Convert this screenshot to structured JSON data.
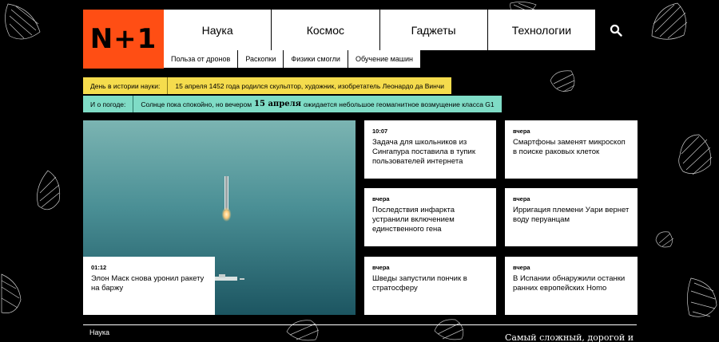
{
  "logo": "N+1",
  "nav": [
    "Наука",
    "Космос",
    "Гаджеты",
    "Технологии"
  ],
  "subnav": [
    "Польза от дронов",
    "Раскопки",
    "Физики смогли",
    "Обучение машин"
  ],
  "history": {
    "label": "День в истории науки:",
    "text": "15 апреля 1452 года родился скульптор, художник, изобретатель Леонардо да Винчи"
  },
  "weather": {
    "label": "И о погоде:",
    "text_before": "Солнце пока спокойно, но вечером",
    "date": "15 апреля",
    "text_after": "ожидается небольшое геомагнитное возмущение класса G1"
  },
  "hero": {
    "time": "01:12",
    "title": "Элон Маск снова уронил ракету на баржу"
  },
  "cards": [
    {
      "time": "10:07",
      "title": "Задача для школьников из Сингапура поставила в тупик пользователей интернета"
    },
    {
      "time": "вчера",
      "title": "Смартфоны заменят микроскоп в поиске раковых клеток"
    },
    {
      "time": "вчера",
      "title": "Последствия инфаркта устранили включением единственного гена"
    },
    {
      "time": "вчера",
      "title": "Ирригация племени Уари вернет воду перуанцам"
    },
    {
      "time": "вчера",
      "title": "Шведы запустили пончик в стратосферу"
    },
    {
      "time": "вчера",
      "title": "В Испании обнаружили останки ранних европейских Homo"
    }
  ],
  "footer": {
    "section": "Наука",
    "promo": "Самый сложный, дорогой и"
  },
  "colors": {
    "logo_bg": "#ff4e14",
    "history_bg": "#f5dc4d",
    "weather_bg": "#7fdcc6",
    "page_bg": "#000000"
  },
  "icons": {
    "search": "search-icon",
    "shells": "seashell-icon"
  }
}
